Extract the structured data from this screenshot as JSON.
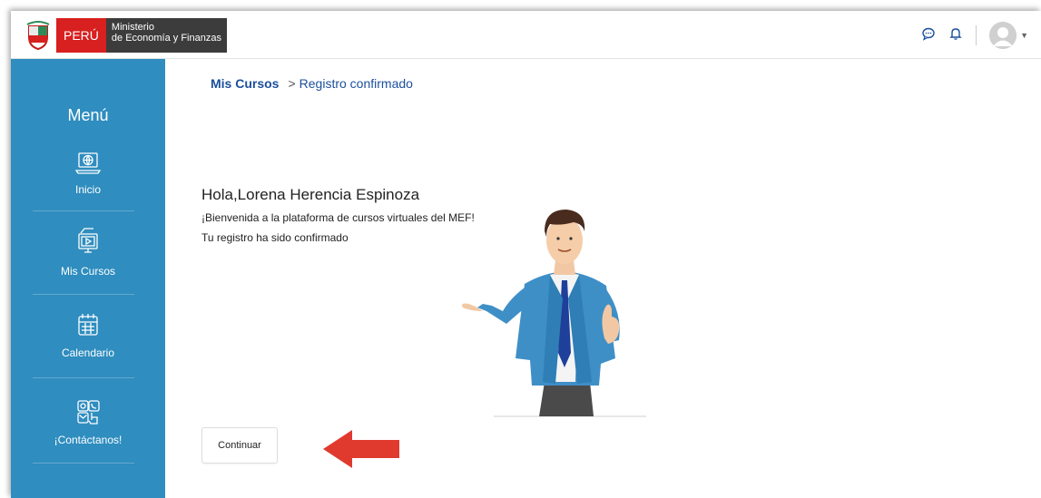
{
  "header": {
    "logo_country": "PERÚ",
    "logo_ministry_line1": "Ministerio",
    "logo_ministry_line2": "de Economía y Finanzas",
    "icons": [
      "chat-icon",
      "bell-icon",
      "user-avatar-icon"
    ]
  },
  "sidebar": {
    "title": "Menú",
    "items": [
      {
        "label": "Inicio",
        "icon": "laptop-globe-icon"
      },
      {
        "label": "Mis Cursos",
        "icon": "video-course-icon"
      },
      {
        "label": "Calendario",
        "icon": "calendar-icon"
      },
      {
        "label": "¡Contáctanos!",
        "icon": "contact-icon"
      }
    ]
  },
  "breadcrumb": {
    "root": "Mis Cursos",
    "separator": ">",
    "current": "Registro confirmado"
  },
  "content": {
    "greeting": "Hola,Lorena Herencia Espinoza",
    "welcome": "¡Bienvenida a la plataforma de cursos virtuales del MEF!",
    "confirmation": "Tu registro ha sido confirmado",
    "continue_label": "Continuar"
  },
  "colors": {
    "sidebar": "#2f8dbf",
    "breadcrumb": "#1b4f9c",
    "arrow": "#e03a2f",
    "logo_red": "#d7201f"
  }
}
